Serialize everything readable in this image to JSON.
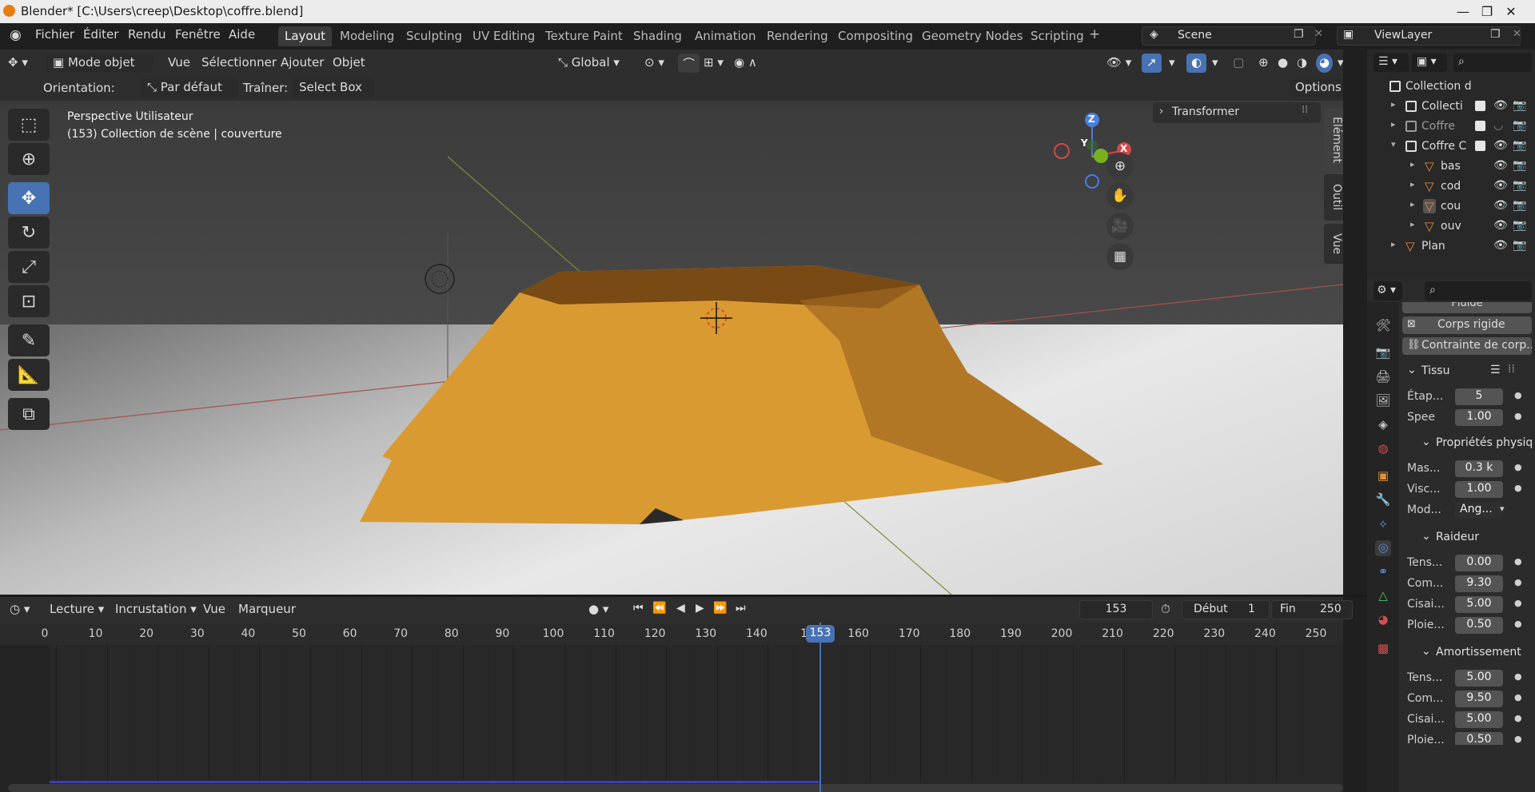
{
  "window": {
    "title": "Blender* [C:\\Users\\creep\\Desktop\\coffre.blend]",
    "min": "—",
    "max": "❐",
    "close": "✕"
  },
  "menu": [
    "Fichier",
    "Éditer",
    "Rendu",
    "Fenêtre",
    "Aide"
  ],
  "workspaces": [
    "Layout",
    "Modeling",
    "Sculpting",
    "UV Editing",
    "Texture Paint",
    "Shading",
    "Animation",
    "Rendering",
    "Compositing",
    "Geometry Nodes",
    "Scripting"
  ],
  "workspace_add": "+",
  "scene": {
    "name": "Scene",
    "view_layer": "ViewLayer"
  },
  "viewport_header": {
    "mode": "Mode objet",
    "items": [
      "Vue",
      "Sélectionner",
      "Ajouter",
      "Objet"
    ],
    "transform": "Global"
  },
  "tool_header": {
    "orientation_label": "Orientation:",
    "orientation_value": "Par défaut",
    "drag_label": "Traîner:",
    "drag_value": "Select Box",
    "options": "Options"
  },
  "viewport": {
    "view_name": "Perspective Utilisateur",
    "collection_info": "(153) Collection de scène | couverture",
    "sidebar_tabs": [
      "Élément",
      "Outil",
      "Vue"
    ],
    "transform_panel": "Transformer",
    "gizmo": {
      "z": "Z",
      "y": "Y",
      "x": "X"
    }
  },
  "outliner": {
    "root": "Collection d",
    "rows": [
      {
        "name": "Collecti",
        "type": "collection"
      },
      {
        "name": "Coffre",
        "type": "collection"
      },
      {
        "name": "Coffre C",
        "type": "collection"
      },
      {
        "name": "bas",
        "type": "mesh"
      },
      {
        "name": "cod",
        "type": "mesh"
      },
      {
        "name": "cou",
        "type": "mesh"
      },
      {
        "name": "ouv",
        "type": "mesh"
      },
      {
        "name": "Plan",
        "type": "mesh"
      }
    ]
  },
  "properties": {
    "top_items": [
      "Fluide",
      "Corps rigide",
      "Contrainte de corp..."
    ],
    "tissu": {
      "title": "Tissu",
      "rows": [
        {
          "label": "Étap...",
          "value": "5"
        },
        {
          "label": "Spee",
          "value": "1.00"
        }
      ]
    },
    "physique": {
      "title": "Propriétés physiq",
      "rows": [
        {
          "label": "Mas...",
          "value": "0.3 k"
        },
        {
          "label": "Visc...",
          "value": "1.00"
        },
        {
          "label": "Mod...",
          "value": "Ang..."
        }
      ]
    },
    "raideur": {
      "title": "Raideur",
      "rows": [
        {
          "label": "Tens...",
          "value": "0.00"
        },
        {
          "label": "Com...",
          "value": "9.30"
        },
        {
          "label": "Cisai...",
          "value": "5.00"
        },
        {
          "label": "Ploie...",
          "value": "0.50"
        }
      ]
    },
    "amortissement": {
      "title": "Amortissement",
      "rows": [
        {
          "label": "Tens...",
          "value": "5.00"
        },
        {
          "label": "Com...",
          "value": "9.50"
        },
        {
          "label": "Cisai...",
          "value": "5.00"
        },
        {
          "label": "Ploie...",
          "value": "0.50"
        }
      ]
    }
  },
  "timeline": {
    "menu": [
      "Lecture",
      "Incrustation",
      "Vue",
      "Marqueur"
    ],
    "current_frame": "153",
    "start_label": "Début",
    "start": "1",
    "end_label": "Fin",
    "end": "250",
    "ruler": [
      "0",
      "10",
      "20",
      "30",
      "40",
      "50",
      "60",
      "70",
      "80",
      "90",
      "100",
      "110",
      "120",
      "130",
      "140",
      "15",
      "160",
      "170",
      "180",
      "190",
      "200",
      "210",
      "220",
      "230",
      "240",
      "250"
    ],
    "playhead": "153"
  },
  "colors": {
    "accent": "#4772b3",
    "cloth": "#d99a32",
    "orange": "#e87d0d"
  }
}
